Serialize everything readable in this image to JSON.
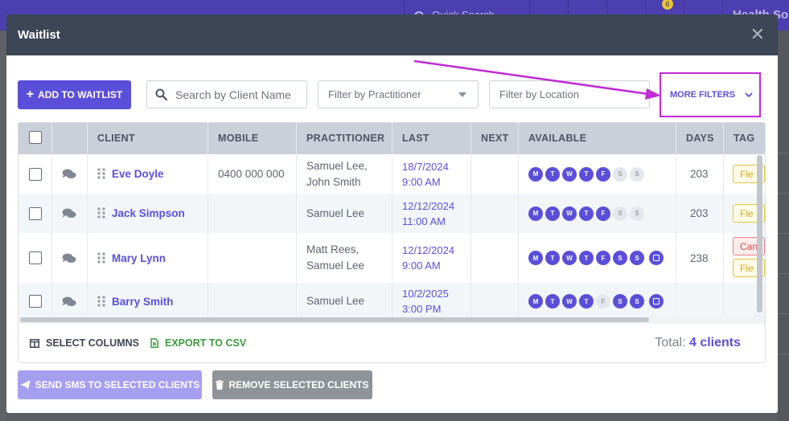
{
  "background": {
    "topbar": {
      "quick_search": "Quick Search",
      "notification_count": "6",
      "brand": "Health So"
    }
  },
  "modal": {
    "title": "Waitlist",
    "close_icon": "close-icon"
  },
  "toolbar": {
    "add_button": "ADD TO WAITLIST",
    "search_placeholder": "Search by Client Name",
    "filter_practitioner": "Filter by Practitioner",
    "filter_location": "Filter by Location",
    "more_filters": "MORE FILTERS"
  },
  "table": {
    "columns": [
      "CLIENT",
      "MOBILE",
      "PRACTITIONER",
      "LAST",
      "NEXT",
      "AVAILABLE",
      "DAYS",
      "TAG"
    ],
    "rows": [
      {
        "client": "Eve Doyle",
        "mobile": "0400 000 000",
        "practitioner_line1": "Samuel Lee,",
        "practitioner_line2": "John Smith",
        "last_date": "18/7/2024",
        "last_time": "9:00 AM",
        "next": "",
        "availability": [
          "M",
          "T",
          "W",
          "T",
          "F",
          "S",
          "S"
        ],
        "availability_on": [
          true,
          true,
          true,
          true,
          true,
          false,
          false
        ],
        "has_note": false,
        "days": "203",
        "tags": [
          "Fle"
        ]
      },
      {
        "client": "Jack Simpson",
        "mobile": "",
        "practitioner_line1": "Samuel Lee",
        "practitioner_line2": "",
        "last_date": "12/12/2024",
        "last_time": "11:00 AM",
        "next": "",
        "availability": [
          "M",
          "T",
          "W",
          "T",
          "F",
          "S",
          "S"
        ],
        "availability_on": [
          true,
          true,
          true,
          true,
          true,
          false,
          false
        ],
        "has_note": false,
        "days": "203",
        "tags": [
          "Fle"
        ]
      },
      {
        "client": "Mary Lynn",
        "mobile": "",
        "practitioner_line1": "Matt Rees,",
        "practitioner_line2": "Samuel Lee",
        "last_date": "12/12/2024",
        "last_time": "9:00 AM",
        "next": "",
        "availability": [
          "M",
          "T",
          "W",
          "T",
          "F",
          "S",
          "S"
        ],
        "availability_on": [
          true,
          true,
          true,
          true,
          true,
          true,
          true
        ],
        "has_note": true,
        "days": "238",
        "tags": [
          "Can",
          "Fle"
        ]
      },
      {
        "client": "Barry Smith",
        "mobile": "",
        "practitioner_line1": "Samuel Lee",
        "practitioner_line2": "",
        "last_date": "10/2/2025",
        "last_time": "3:00 PM",
        "next": "",
        "availability": [
          "M",
          "T",
          "W",
          "T",
          "F",
          "S",
          "S"
        ],
        "availability_on": [
          true,
          true,
          true,
          true,
          false,
          true,
          true
        ],
        "has_note": true,
        "days": "",
        "tags": []
      }
    ]
  },
  "footer": {
    "select_columns": "SELECT COLUMNS",
    "export_csv": "EXPORT TO CSV",
    "total_label": "Total:",
    "total_value": "4 clients"
  },
  "actions": {
    "send_sms": "SEND SMS TO SELECTED CLIENTS",
    "remove": "REMOVE SELECTED CLIENTS"
  },
  "colors": {
    "accent": "#5b4fd9",
    "header": "#3c4654",
    "annotation": "#c02bd6",
    "export_green": "#3b9a3b"
  }
}
